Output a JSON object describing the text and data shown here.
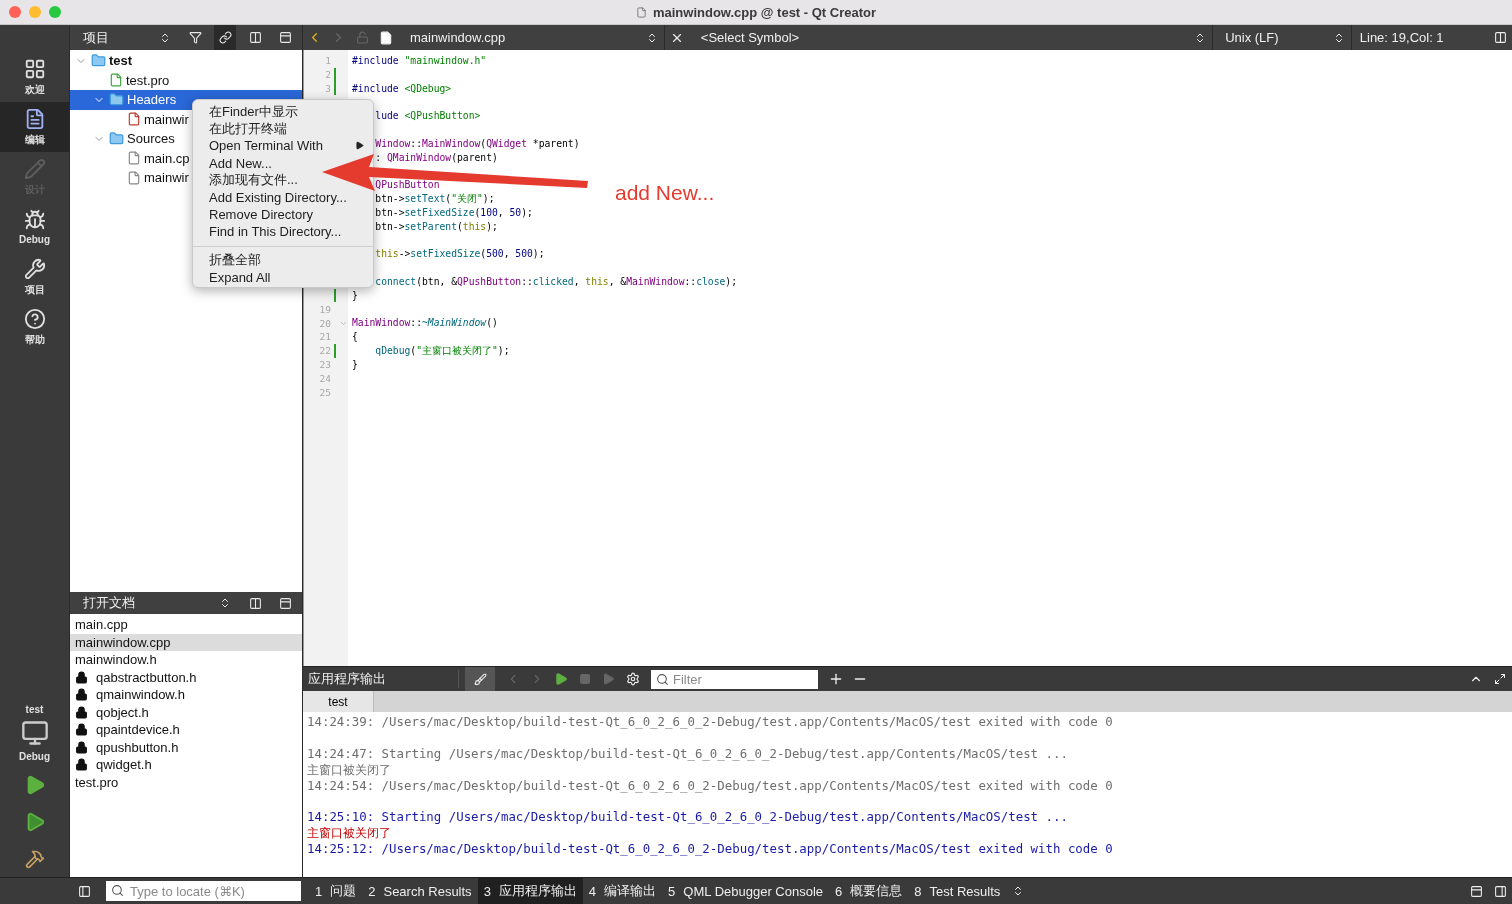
{
  "window": {
    "title": "mainwindow.cpp @ test - Qt Creator"
  },
  "mode_bar": {
    "items": [
      {
        "kind": "welcome",
        "label": "欢迎",
        "selected": false,
        "disabled": false
      },
      {
        "kind": "edit",
        "label": "编辑",
        "selected": true,
        "disabled": false
      },
      {
        "kind": "design",
        "label": "设计",
        "selected": false,
        "disabled": true
      },
      {
        "kind": "debug",
        "label": "Debug",
        "selected": false,
        "disabled": false
      },
      {
        "kind": "projects",
        "label": "项目",
        "selected": false,
        "disabled": false
      },
      {
        "kind": "help",
        "label": "帮助",
        "selected": false,
        "disabled": false
      }
    ],
    "kit": {
      "project": "test",
      "build": "Debug"
    }
  },
  "project_panel": {
    "title": "项目",
    "tree": [
      {
        "label": "test",
        "kind": "project",
        "expanded": true,
        "selected": false,
        "children": [
          {
            "label": "test.pro",
            "kind": "pro",
            "selected": false
          },
          {
            "label": "Headers",
            "kind": "headers",
            "expanded": true,
            "selected": true,
            "children": [
              {
                "label": "mainwir",
                "kind": "header",
                "selected": false
              }
            ]
          },
          {
            "label": "Sources",
            "kind": "sources",
            "expanded": true,
            "selected": false,
            "children": [
              {
                "label": "main.cp",
                "kind": "source",
                "selected": false
              },
              {
                "label": "mainwir",
                "kind": "source",
                "selected": false
              }
            ]
          }
        ]
      }
    ]
  },
  "open_documents": {
    "title": "打开文档",
    "items": [
      {
        "name": "main.cpp",
        "locked": false,
        "selected": false
      },
      {
        "name": "mainwindow.cpp",
        "locked": false,
        "selected": true
      },
      {
        "name": "mainwindow.h",
        "locked": false,
        "selected": false
      },
      {
        "name": "qabstractbutton.h",
        "locked": true,
        "selected": false
      },
      {
        "name": "qmainwindow.h",
        "locked": true,
        "selected": false
      },
      {
        "name": "qobject.h",
        "locked": true,
        "selected": false
      },
      {
        "name": "qpaintdevice.h",
        "locked": true,
        "selected": false
      },
      {
        "name": "qpushbutton.h",
        "locked": true,
        "selected": false
      },
      {
        "name": "qwidget.h",
        "locked": true,
        "selected": false
      },
      {
        "name": "test.pro",
        "locked": false,
        "selected": false
      }
    ]
  },
  "editor_toolbar": {
    "file": "mainwindow.cpp",
    "symbol": "<Select Symbol>",
    "line_endings": "Unix (LF)",
    "position": "Line: 19,Col: 1"
  },
  "code_lines": [
    {
      "number": "1",
      "kind": "code",
      "changed": false,
      "foldable": false,
      "indented": false,
      "segments": [
        {
          "kind": "preproc",
          "text": "#include"
        },
        {
          "kind": "string",
          "text": " \"mainwindow.h\""
        }
      ]
    },
    {
      "number": "2",
      "kind": "blank",
      "changed": true,
      "foldable": false
    },
    {
      "number": "3",
      "kind": "code",
      "changed": true,
      "foldable": false,
      "indented": false,
      "segments": [
        {
          "kind": "preproc",
          "text": "#include"
        },
        {
          "kind": "string",
          "text": " <QDebug>"
        }
      ]
    },
    {
      "kind": "blank"
    },
    {
      "kind": "code",
      "indented": true,
      "segments": [
        {
          "kind": "preproc",
          "text": "lude"
        },
        {
          "kind": "string",
          "text": " <QPushButton>"
        }
      ]
    },
    {
      "kind": "blank"
    },
    {
      "kind": "code",
      "indented": true,
      "segments": [
        {
          "kind": "type",
          "text": "Window"
        },
        {
          "kind": "plain",
          "text": "::"
        },
        {
          "kind": "type",
          "text": "MainWindow"
        },
        {
          "kind": "plain",
          "text": "("
        },
        {
          "kind": "type",
          "text": "QWidget"
        },
        {
          "kind": "plain",
          "text": " *parent)"
        }
      ]
    },
    {
      "kind": "code",
      "indented": true,
      "segments": [
        {
          "kind": "plain",
          "text": ": "
        },
        {
          "kind": "type",
          "text": "QMainWindow"
        },
        {
          "kind": "plain",
          "text": "(parent)"
        }
      ]
    },
    {
      "kind": "blank"
    },
    {
      "kind": "code",
      "indented": true,
      "segments": [
        {
          "kind": "type",
          "text": "QPushButton"
        }
      ]
    },
    {
      "kind": "code",
      "indented": true,
      "segments": [
        {
          "kind": "plain",
          "text": "btn->"
        },
        {
          "kind": "func",
          "text": "setText"
        },
        {
          "kind": "plain",
          "text": "("
        },
        {
          "kind": "string",
          "text": "\"关闭\""
        },
        {
          "kind": "plain",
          "text": ");"
        }
      ]
    },
    {
      "kind": "code",
      "indented": true,
      "segments": [
        {
          "kind": "plain",
          "text": "btn->"
        },
        {
          "kind": "func",
          "text": "setFixedSize"
        },
        {
          "kind": "plain",
          "text": "("
        },
        {
          "kind": "number",
          "text": "100"
        },
        {
          "kind": "plain",
          "text": ", "
        },
        {
          "kind": "number",
          "text": "50"
        },
        {
          "kind": "plain",
          "text": ");"
        }
      ]
    },
    {
      "kind": "code",
      "indented": true,
      "segments": [
        {
          "kind": "plain",
          "text": "btn->"
        },
        {
          "kind": "func",
          "text": "setParent"
        },
        {
          "kind": "plain",
          "text": "("
        },
        {
          "kind": "keyword",
          "text": "this"
        },
        {
          "kind": "plain",
          "text": ");"
        }
      ]
    },
    {
      "kind": "blank"
    },
    {
      "kind": "code",
      "indented": true,
      "segments": [
        {
          "kind": "keyword",
          "text": "this"
        },
        {
          "kind": "plain",
          "text": "->"
        },
        {
          "kind": "func",
          "text": "setFixedSize"
        },
        {
          "kind": "plain",
          "text": "("
        },
        {
          "kind": "number",
          "text": "500"
        },
        {
          "kind": "plain",
          "text": ", "
        },
        {
          "kind": "number",
          "text": "500"
        },
        {
          "kind": "plain",
          "text": ");"
        }
      ]
    },
    {
      "kind": "blank"
    },
    {
      "kind": "code",
      "indented": true,
      "segments": [
        {
          "kind": "func",
          "text": "connect"
        },
        {
          "kind": "plain",
          "text": "(btn, &"
        },
        {
          "kind": "type",
          "text": "QPushButton"
        },
        {
          "kind": "plain",
          "text": "::"
        },
        {
          "kind": "func",
          "text": "clicked"
        },
        {
          "kind": "plain",
          "text": ", "
        },
        {
          "kind": "keyword",
          "text": "this"
        },
        {
          "kind": "plain",
          "text": ", &"
        },
        {
          "kind": "type",
          "text": "MainWindow"
        },
        {
          "kind": "plain",
          "text": "::"
        },
        {
          "kind": "func",
          "text": "close"
        },
        {
          "kind": "plain",
          "text": ");"
        }
      ]
    },
    {
      "kind": "code",
      "changed": true,
      "foldable": false,
      "indented": false,
      "segments": [
        {
          "kind": "plain",
          "text": "}"
        }
      ]
    },
    {
      "number": "19",
      "kind": "blank",
      "changed": false,
      "foldable": false
    },
    {
      "number": "20",
      "kind": "code",
      "changed": false,
      "foldable": true,
      "indented": false,
      "segments": [
        {
          "kind": "type",
          "text": "MainWindow"
        },
        {
          "kind": "plain",
          "text": "::"
        },
        {
          "kind": "dtor",
          "text": "~MainWindow"
        },
        {
          "kind": "plain",
          "text": "()"
        }
      ]
    },
    {
      "number": "21",
      "kind": "code",
      "changed": false,
      "foldable": false,
      "indented": false,
      "segments": [
        {
          "kind": "plain",
          "text": "{"
        }
      ]
    },
    {
      "number": "22",
      "kind": "code",
      "changed": true,
      "foldable": false,
      "indented": true,
      "segments": [
        {
          "kind": "func",
          "text": "qDebug"
        },
        {
          "kind": "plain",
          "text": "("
        },
        {
          "kind": "string",
          "text": "\"主窗口被关闭了\""
        },
        {
          "kind": "plain",
          "text": ");"
        }
      ]
    },
    {
      "number": "23",
      "kind": "code",
      "changed": false,
      "foldable": false,
      "indented": false,
      "segments": [
        {
          "kind": "plain",
          "text": "}"
        }
      ]
    },
    {
      "number": "24",
      "kind": "blank",
      "changed": false,
      "foldable": false
    },
    {
      "number": "25",
      "kind": "blank",
      "changed": false,
      "foldable": false
    }
  ],
  "context_menu": {
    "groups": [
      [
        {
          "label": "在Finder中显示",
          "has_submenu": false
        },
        {
          "label": "在此打开终端",
          "has_submenu": false
        },
        {
          "label": "Open Terminal With",
          "has_submenu": true
        },
        {
          "label": "Add New...",
          "has_submenu": false
        },
        {
          "label": "添加现有文件...",
          "has_submenu": false
        },
        {
          "label": "Add Existing Directory...",
          "has_submenu": false
        },
        {
          "label": "Remove Directory",
          "has_submenu": false
        },
        {
          "label": "Find in This Directory...",
          "has_submenu": false
        }
      ],
      [
        {
          "label": "折叠全部",
          "has_submenu": false
        },
        {
          "label": "Expand All",
          "has_submenu": false
        }
      ]
    ]
  },
  "annotation": {
    "text": "add New..."
  },
  "output_pane": {
    "title": "应用程序输出",
    "filter_placeholder": "Filter",
    "tabs": [
      {
        "label": "test",
        "selected": true
      }
    ],
    "runs": [
      {
        "lines": [
          {
            "kind": "old",
            "text": "14:24:39: /Users/mac/Desktop/build-test-Qt_6_0_2_6_0_2-Debug/test.app/Contents/MacOS/test exited with code 0"
          }
        ]
      },
      {
        "lines": [
          {
            "kind": "old",
            "text": "14:24:47: Starting /Users/mac/Desktop/build-test-Qt_6_0_2_6_0_2-Debug/test.app/Contents/MacOS/test ..."
          },
          {
            "kind": "old",
            "text": "主窗口被关闭了"
          },
          {
            "kind": "old",
            "text": "14:24:54: /Users/mac/Desktop/build-test-Qt_6_0_2_6_0_2-Debug/test.app/Contents/MacOS/test exited with code 0"
          }
        ]
      },
      {
        "lines": [
          {
            "kind": "current",
            "text": "14:25:10: Starting /Users/mac/Desktop/build-test-Qt_6_0_2_6_0_2-Debug/test.app/Contents/MacOS/test ..."
          },
          {
            "kind": "error",
            "text": "主窗口被关闭了"
          },
          {
            "kind": "current",
            "text": "14:25:12: /Users/mac/Desktop/build-test-Qt_6_0_2_6_0_2-Debug/test.app/Contents/MacOS/test exited with code 0"
          }
        ]
      }
    ]
  },
  "status_bar": {
    "locate_placeholder": "Type to locate (⌘K)",
    "panes": [
      {
        "number": "1",
        "label": "问题",
        "selected": false
      },
      {
        "number": "2",
        "label": "Search Results",
        "selected": false
      },
      {
        "number": "3",
        "label": "应用程序输出",
        "selected": true
      },
      {
        "number": "4",
        "label": "编译输出",
        "selected": false
      },
      {
        "number": "5",
        "label": "QML Debugger Console",
        "selected": false
      },
      {
        "number": "6",
        "label": "概要信息",
        "selected": false
      },
      {
        "number": "8",
        "label": "Test Results",
        "selected": false
      }
    ]
  }
}
